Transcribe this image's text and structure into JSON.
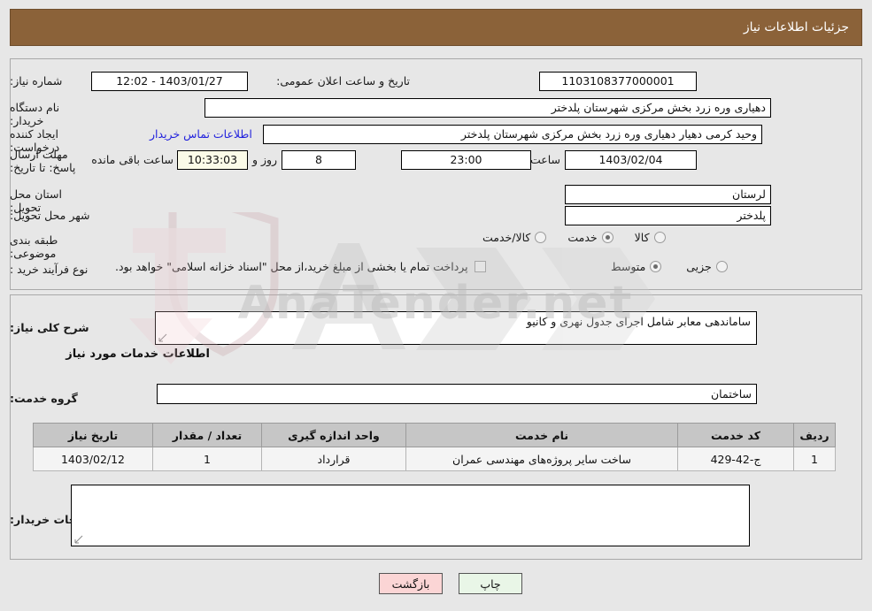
{
  "header": {
    "title": "جزئیات اطلاعات نیاز"
  },
  "top": {
    "need_number_label": "شماره نیاز:",
    "need_number_value": "1103108377000001",
    "announce_label": "تاریخ و ساعت اعلان عمومی:",
    "announce_value": "1403/01/27 - 12:02",
    "buyer_org_label": "نام دستگاه خریدار:",
    "buyer_org_value": "دهیاری وره زرد بخش مرکزی شهرستان پلدختر",
    "requester_label": "ایجاد کننده درخواست:",
    "requester_value": "وحید کرمی دهیار دهیاری وره زرد بخش مرکزی شهرستان پلدختر",
    "contact_link": "اطلاعات تماس خریدار",
    "deadline_label": "مهلت ارسال پاسخ: تا تاریخ:",
    "deadline_date": "1403/02/04",
    "hour_label": "ساعت",
    "deadline_time": "23:00",
    "days_remaining": "8",
    "days_and_label": "روز و",
    "countdown": "10:33:03",
    "hours_remaining_label": "ساعت باقی مانده",
    "province_label": "استان محل تحویل:",
    "province_value": "لرستان",
    "city_label": "شهر محل تحویل:",
    "city_value": "پلدختر",
    "category_label": "طبقه بندی موضوعی:",
    "category_options": [
      {
        "label": "کالا",
        "selected": false
      },
      {
        "label": "خدمت",
        "selected": true
      },
      {
        "label": "کالا/خدمت",
        "selected": false
      }
    ],
    "process_label": "نوع فرآیند خرید :",
    "process_options": [
      {
        "label": "جزیی",
        "selected": false
      },
      {
        "label": "متوسط",
        "selected": true
      }
    ],
    "treasury_checkbox_label": "پرداخت تمام یا بخشی از مبلغ خرید،از محل \"اسناد خزانه اسلامی\" خواهد بود.",
    "treasury_checked": false
  },
  "mid": {
    "general_desc_label": "شرح کلی نیاز:",
    "general_desc_value": "ساماندهی معابر شامل اجرای جدول نهری و کانیو",
    "services_section_title": "اطلاعات خدمات مورد نیاز",
    "service_group_label": "گروه خدمت:",
    "service_group_value": "ساختمان",
    "table": {
      "columns": [
        "ردیف",
        "کد خدمت",
        "نام خدمت",
        "واحد اندازه گیری",
        "تعداد / مقدار",
        "تاریخ نیاز"
      ],
      "rows": [
        {
          "index": "1",
          "code": "ج-42-429",
          "name": "ساخت سایر پروژه‌های مهندسی عمران",
          "unit": "قرارداد",
          "quantity": "1",
          "date": "1403/02/12"
        }
      ]
    },
    "buyer_notes_label": "توضیحات خریدار:",
    "buyer_notes_value": ""
  },
  "footer": {
    "print_label": "چاپ",
    "back_label": "بازگشت"
  },
  "watermark": {
    "text": "AnaTender.net"
  },
  "colors": {
    "header_bar": "#8b6239",
    "link": "#2222dd",
    "table_header": "#c6c6c6",
    "print_button": "#e9f6e7",
    "back_button": "#fbd5d5",
    "countdown_field": "#fbfbe8"
  }
}
